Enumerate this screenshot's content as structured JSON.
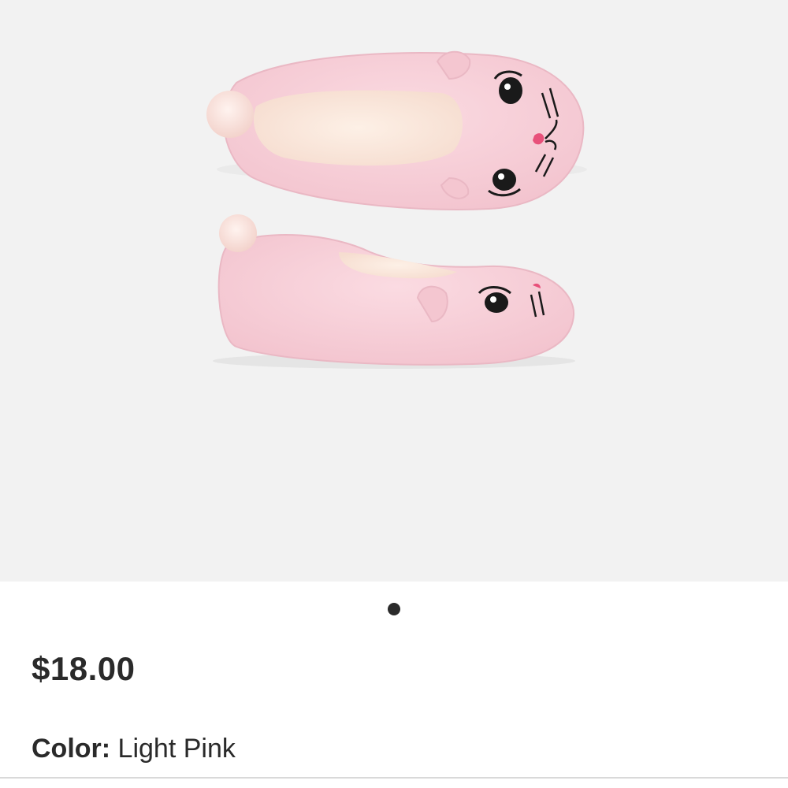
{
  "product": {
    "image_alt": "Light pink cat face slippers with pom-pom",
    "price": "$18.00",
    "color_label": "Color:",
    "color_value": "Light Pink"
  },
  "gallery": {
    "page_count": 1,
    "active_index": 0
  },
  "colors": {
    "image_background": "#f2f2f2",
    "slipper_pink": "#f7cfd8",
    "lining": "#fbe8dc",
    "text": "#2a2a2a",
    "nose": "#e8507a"
  }
}
